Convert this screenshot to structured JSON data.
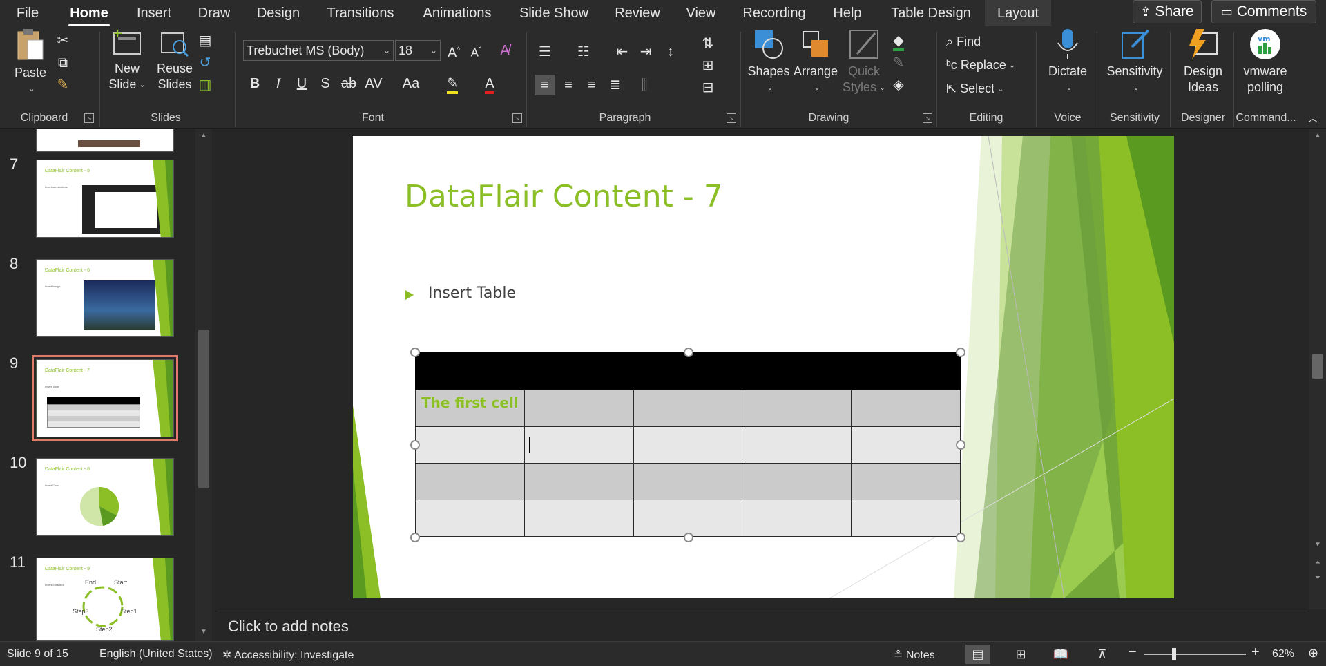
{
  "tabs": [
    {
      "label": "File"
    },
    {
      "label": "Home"
    },
    {
      "label": "Insert"
    },
    {
      "label": "Draw"
    },
    {
      "label": "Design"
    },
    {
      "label": "Transitions"
    },
    {
      "label": "Animations"
    },
    {
      "label": "Slide Show"
    },
    {
      "label": "Review"
    },
    {
      "label": "View"
    },
    {
      "label": "Recording"
    },
    {
      "label": "Help"
    },
    {
      "label": "Table Design"
    },
    {
      "label": "Layout"
    }
  ],
  "active_tab": "Home",
  "top_buttons": {
    "share": "Share",
    "comments": "Comments"
  },
  "ribbon": {
    "clipboard": {
      "label": "Clipboard",
      "paste": "Paste"
    },
    "slides": {
      "label": "Slides",
      "new_slide_1": "New",
      "new_slide_2": "Slide",
      "reuse_1": "Reuse",
      "reuse_2": "Slides"
    },
    "font": {
      "label": "Font",
      "font_name": "Trebuchet MS (Body)",
      "font_size": "18"
    },
    "paragraph": {
      "label": "Paragraph"
    },
    "drawing": {
      "label": "Drawing",
      "shapes": "Shapes",
      "arrange": "Arrange",
      "quick_styles_1": "Quick",
      "quick_styles_2": "Styles"
    },
    "editing": {
      "label": "Editing",
      "find": "Find",
      "replace": "Replace",
      "select": "Select"
    },
    "voice": {
      "label": "Voice",
      "dictate": "Dictate"
    },
    "sensitivity": {
      "label": "Sensitivity",
      "button": "Sensitivity"
    },
    "designer": {
      "label": "Designer",
      "btn_1": "Design",
      "btn_2": "Ideas"
    },
    "commands": {
      "label": "Command...",
      "btn_1": "vmware",
      "btn_2": "polling"
    }
  },
  "thumbnails": [
    {
      "number": "7",
      "title": "DataFlair Content - 5",
      "bullet": "Insert screenshots"
    },
    {
      "number": "8",
      "title": "DataFlair Content - 6",
      "bullet": "Insert Image"
    },
    {
      "number": "9",
      "title": "DataFlair Content - 7",
      "bullet": "Insert Table"
    },
    {
      "number": "10",
      "title": "DataFlair Content - 8",
      "bullet": "Insert Chart"
    },
    {
      "number": "11",
      "title": "DataFlair Content - 9",
      "bullet": "Insert SmartArt",
      "labels": [
        "End",
        "Start",
        "Step3",
        "Step1",
        "Step2"
      ]
    }
  ],
  "slide": {
    "title": "DataFlair Content - 7",
    "bullet": "Insert Table",
    "first_cell": "The first cell",
    "page_number": "9",
    "table_rows": 5,
    "table_cols": 5
  },
  "notes_placeholder": "Click to add notes",
  "status": {
    "slide_indicator": "Slide 9 of 15",
    "language": "English (United States)",
    "accessibility": "Accessibility: Investigate",
    "notes": "Notes",
    "zoom": "62%"
  },
  "colors": {
    "accent_green": "#8cbf26",
    "selection_outline": "#e07a6a",
    "ui_dark": "#2b2b2b"
  }
}
